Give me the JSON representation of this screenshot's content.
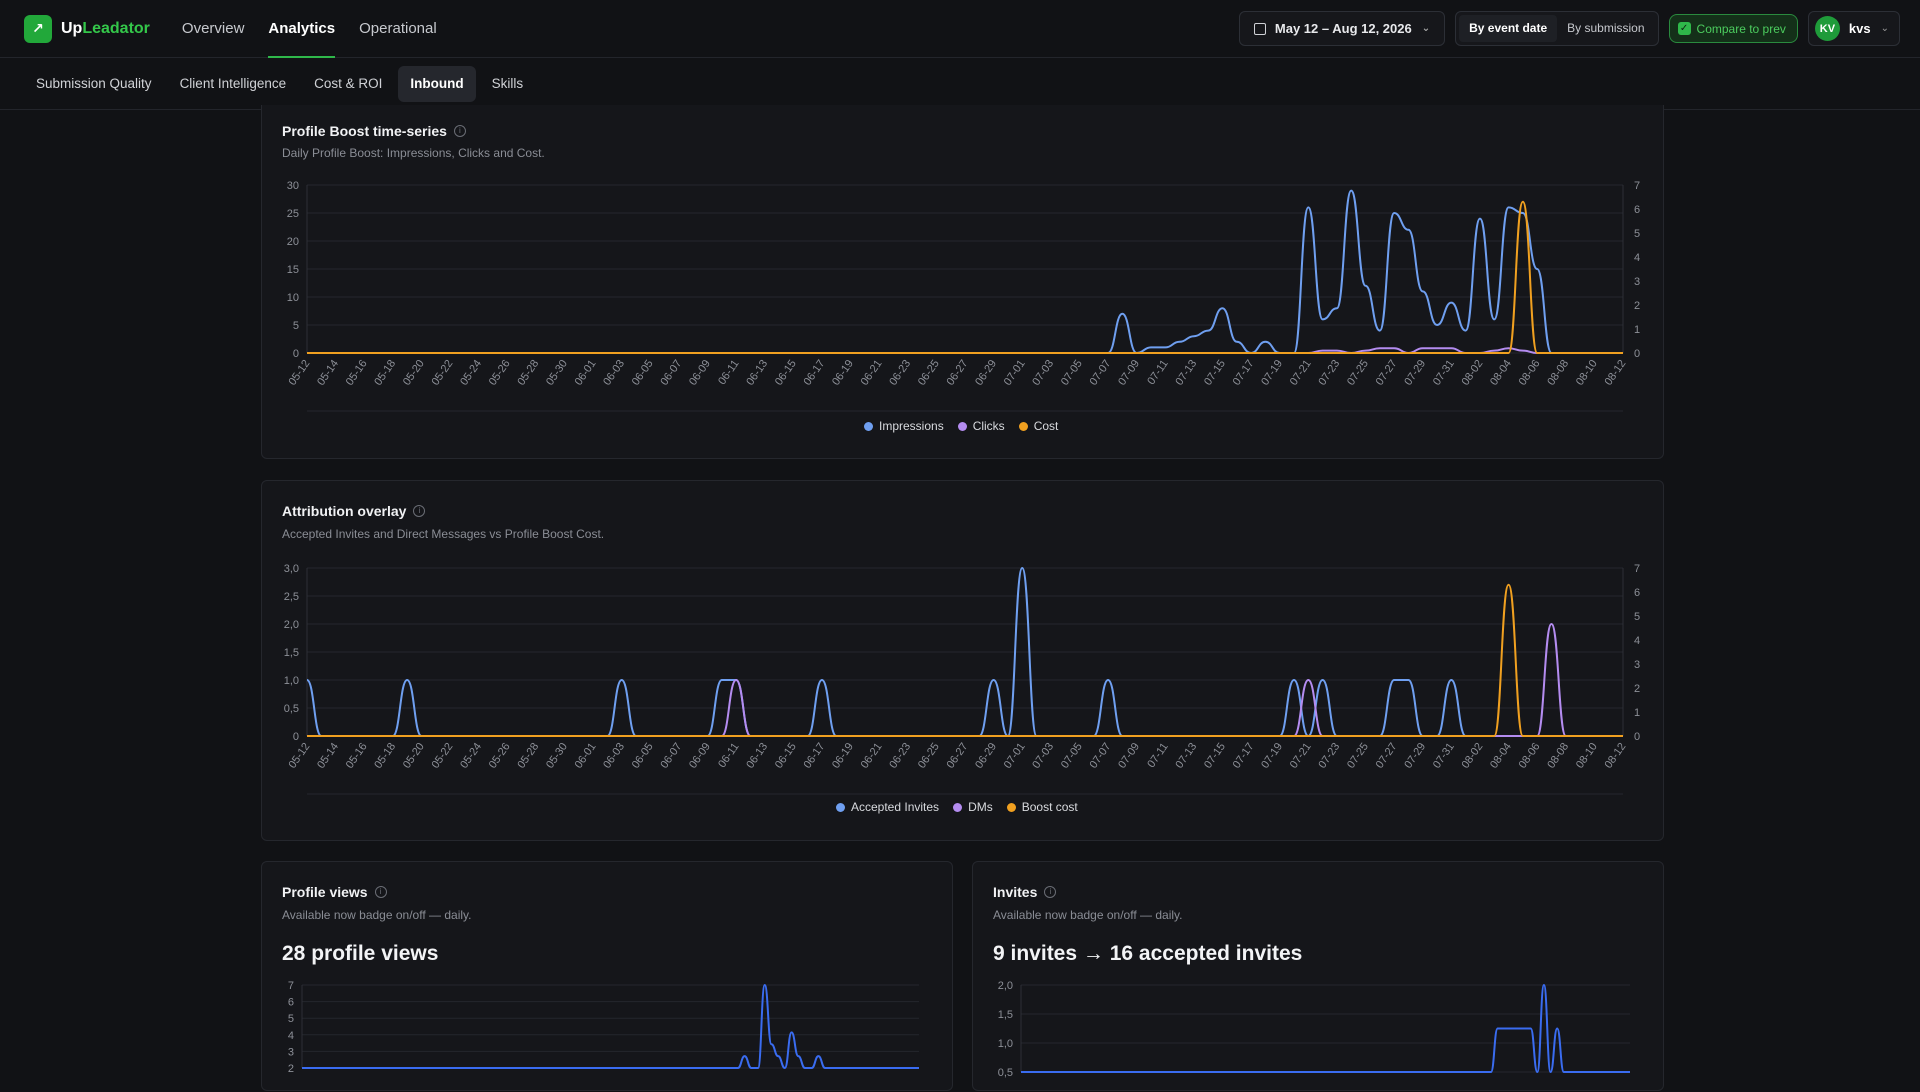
{
  "app": {
    "logo_up": "Up",
    "logo_lead": "Leadator",
    "nav": [
      {
        "label": "Overview"
      },
      {
        "label": "Analytics"
      },
      {
        "label": "Operational"
      }
    ],
    "date_range": "May 12 – Aug 12, 2026",
    "mode_event": "By event date",
    "mode_submission": "By submission",
    "compare_label": "Compare to prev",
    "user_initials": "KV",
    "user_name": "kvs"
  },
  "subnav": [
    {
      "label": "Submission Quality"
    },
    {
      "label": "Client Intelligence"
    },
    {
      "label": "Cost & ROI"
    },
    {
      "label": "Inbound"
    },
    {
      "label": "Skills"
    }
  ],
  "cards": {
    "boost": {
      "title": "Profile Boost time-series",
      "subtitle": "Daily Profile Boost: Impressions, Clicks and Cost.",
      "legend": [
        "Impressions",
        "Clicks",
        "Cost"
      ]
    },
    "attribution": {
      "title": "Attribution overlay",
      "subtitle": "Accepted Invites and Direct Messages vs Profile Boost Cost.",
      "legend": [
        "Accepted Invites",
        "DMs",
        "Boost cost"
      ]
    },
    "views": {
      "title": "Profile views",
      "subtitle": "Available now badge on/off — daily.",
      "headline": "28 profile views"
    },
    "invites": {
      "title": "Invites",
      "subtitle": "Available now badge on/off — daily.",
      "headline": "9 invites → 16 accepted invites"
    }
  },
  "colors": {
    "impressions": "#6f9ff0",
    "clicks": "#b48cf0",
    "cost": "#f0a020",
    "views_line": "#3a6cf0"
  },
  "chart_data": [
    {
      "type": "line",
      "x_ticks": [
        "05-12",
        "05-14",
        "05-16",
        "05-18",
        "05-20",
        "05-22",
        "05-24",
        "05-26",
        "05-28",
        "05-30",
        "06-01",
        "06-03",
        "06-05",
        "06-07",
        "06-09",
        "06-11",
        "06-13",
        "06-15",
        "06-17",
        "06-19",
        "06-21",
        "06-23",
        "06-25",
        "06-27",
        "06-29",
        "07-01",
        "07-03",
        "07-05",
        "07-07",
        "07-09",
        "07-11",
        "07-13",
        "07-15",
        "07-17",
        "07-19",
        "07-21",
        "07-23",
        "07-25",
        "07-27",
        "07-29",
        "07-31",
        "08-02",
        "08-04",
        "08-06",
        "08-08",
        "08-10",
        "08-12"
      ],
      "y_ticks": [
        "0",
        "5",
        "10",
        "15",
        "20",
        "25",
        "30"
      ],
      "y2_ticks": [
        "0",
        "1",
        "2",
        "3",
        "4",
        "5",
        "6",
        "7"
      ],
      "ylim": [
        0,
        30
      ],
      "y2lim": [
        0,
        7
      ],
      "series": [
        {
          "name": "Impressions",
          "axis": "left",
          "points": [
            [
              56,
              0
            ],
            [
              57,
              7
            ],
            [
              58,
              0
            ],
            [
              59,
              1
            ],
            [
              60,
              1
            ],
            [
              61,
              2
            ],
            [
              62,
              3
            ],
            [
              63,
              4
            ],
            [
              64,
              8
            ],
            [
              65,
              2
            ],
            [
              66,
              0
            ],
            [
              67,
              2
            ],
            [
              68,
              0
            ],
            [
              69,
              0
            ],
            [
              70,
              26
            ],
            [
              71,
              6
            ],
            [
              72,
              8
            ],
            [
              73,
              29
            ],
            [
              74,
              12
            ],
            [
              75,
              4
            ],
            [
              76,
              25
            ],
            [
              77,
              22
            ],
            [
              78,
              11
            ],
            [
              79,
              5
            ],
            [
              80,
              9
            ],
            [
              81,
              4
            ],
            [
              82,
              24
            ],
            [
              83,
              6
            ],
            [
              84,
              26
            ],
            [
              85,
              25
            ],
            [
              86,
              15
            ],
            [
              87,
              0
            ]
          ]
        },
        {
          "name": "Clicks",
          "axis": "right",
          "points": [
            [
              70,
              0
            ],
            [
              71,
              0.1
            ],
            [
              72,
              0.1
            ],
            [
              74,
              0.1
            ],
            [
              75,
              0.2
            ],
            [
              76,
              0.2
            ],
            [
              78,
              0.2
            ],
            [
              79,
              0.2
            ],
            [
              80,
              0.2
            ],
            [
              83,
              0.1
            ],
            [
              84,
              0.2
            ],
            [
              85,
              0.1
            ],
            [
              86,
              0
            ]
          ]
        },
        {
          "name": "Cost",
          "axis": "right",
          "points": [
            [
              84,
              0
            ],
            [
              85,
              6.3
            ],
            [
              86,
              0
            ]
          ]
        }
      ]
    },
    {
      "type": "line",
      "x_ticks": [
        "05-12",
        "05-14",
        "05-16",
        "05-18",
        "05-20",
        "05-22",
        "05-24",
        "05-26",
        "05-28",
        "05-30",
        "06-01",
        "06-03",
        "06-05",
        "06-07",
        "06-09",
        "06-11",
        "06-13",
        "06-15",
        "06-17",
        "06-19",
        "06-21",
        "06-23",
        "06-25",
        "06-27",
        "06-29",
        "07-01",
        "07-03",
        "07-05",
        "07-07",
        "07-09",
        "07-11",
        "07-13",
        "07-15",
        "07-17",
        "07-19",
        "07-21",
        "07-23",
        "07-25",
        "07-27",
        "07-29",
        "07-31",
        "08-02",
        "08-04",
        "08-06",
        "08-08",
        "08-10",
        "08-12"
      ],
      "y_ticks": [
        "0",
        "0,5",
        "1,0",
        "1,5",
        "2,0",
        "2,5",
        "3,0"
      ],
      "y2_ticks": [
        "0",
        "1",
        "2",
        "3",
        "4",
        "5",
        "6",
        "7"
      ],
      "ylim": [
        0,
        3
      ],
      "y2lim": [
        0,
        7
      ],
      "series": [
        {
          "name": "Accepted Invites",
          "axis": "left",
          "points": [
            [
              0,
              1
            ],
            [
              7,
              1
            ],
            [
              22,
              1
            ],
            [
              29,
              1
            ],
            [
              30,
              1
            ],
            [
              36,
              1
            ],
            [
              48,
              1
            ],
            [
              50,
              3
            ],
            [
              56,
              1
            ],
            [
              69,
              1
            ],
            [
              71,
              1
            ],
            [
              76,
              1
            ],
            [
              77,
              1
            ],
            [
              80,
              1
            ]
          ]
        },
        {
          "name": "DMs",
          "axis": "left",
          "points": [
            [
              30,
              1
            ],
            [
              70,
              1
            ],
            [
              87,
              2
            ]
          ]
        },
        {
          "name": "Boost cost",
          "axis": "right",
          "points": [
            [
              84,
              6.3
            ]
          ]
        }
      ]
    },
    {
      "type": "line",
      "y_ticks": [
        "2",
        "3",
        "4",
        "5",
        "6",
        "7"
      ],
      "ylim": [
        0,
        7
      ],
      "series": [
        {
          "name": "Profile views",
          "points": [
            [
              66,
              1
            ],
            [
              69,
              7
            ],
            [
              70,
              2
            ],
            [
              71,
              1
            ],
            [
              73,
              3
            ],
            [
              74,
              1
            ],
            [
              77,
              1
            ]
          ]
        }
      ]
    },
    {
      "type": "line",
      "y_ticks": [
        "0,5",
        "1,0",
        "1,5",
        "2,0"
      ],
      "ylim": [
        0,
        2
      ],
      "series": [
        {
          "name": "Invites",
          "points": [
            [
              72,
              1
            ],
            [
              73,
              1
            ],
            [
              74,
              1
            ],
            [
              75,
              1
            ],
            [
              76,
              1
            ],
            [
              77,
              1
            ],
            [
              79,
              2
            ],
            [
              81,
              1
            ]
          ]
        }
      ]
    }
  ]
}
